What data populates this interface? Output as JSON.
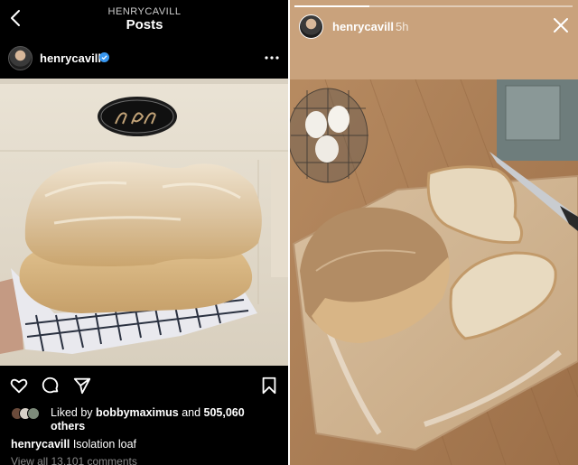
{
  "left_post": {
    "header": {
      "subtitle": "HENRYCAVILL",
      "title": "Posts"
    },
    "user": {
      "username": "henrycavill"
    },
    "post": {
      "liked_prefix": "Liked by ",
      "liked_by": "bobbymaximus",
      "liked_and": " and ",
      "liked_count": "505,060",
      "liked_suffix": "others",
      "caption_user": "henrycavill",
      "caption_text": "Isolation loaf",
      "view_all": "View all 13,101 comments"
    },
    "icons": [
      "back-icon",
      "verified-icon",
      "more-icon",
      "heart-icon",
      "comment-icon",
      "share-icon",
      "bookmark-icon"
    ]
  },
  "right_story": {
    "user": {
      "username": "henrycavill",
      "time": "5h"
    },
    "progress": 0.27,
    "icons": [
      "close-icon"
    ]
  },
  "colors": {
    "background": "#000000",
    "text": "#ffffff",
    "muted": "#8a8a8a",
    "verified": "#3897f0",
    "story_bg": "#c39b74"
  }
}
